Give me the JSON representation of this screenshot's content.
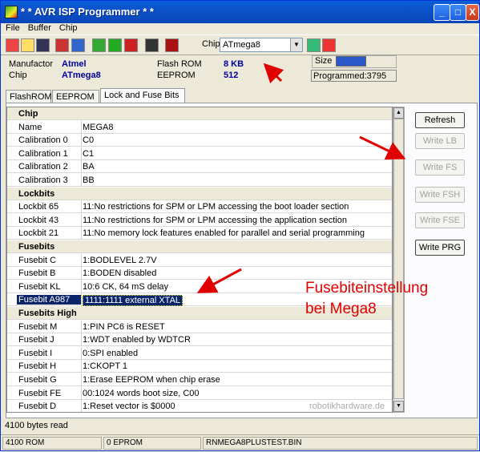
{
  "window": {
    "title": "* * AVR ISP Programmer * *",
    "min": "_",
    "max": "□",
    "close": "X"
  },
  "menu": [
    "File",
    "Buffer",
    "Chip"
  ],
  "toolbar": {
    "chip_label": "Chip",
    "chip_value": "ATmega8"
  },
  "info": {
    "manufacturer_label": "Manufactor",
    "manufacturer": "Atmel",
    "chip_label": "Chip",
    "chip": "ATmega8",
    "flash_label": "Flash ROM",
    "flash": "8 KB",
    "eeprom_label": "EEPROM",
    "eeprom": "512",
    "size_label": "Size",
    "programmed": "Programmed:3795"
  },
  "tabs": [
    "FlashROM",
    "EEPROM",
    "Lock and Fuse Bits"
  ],
  "rows": [
    {
      "n": "Chip",
      "h": true
    },
    {
      "n": "Name",
      "v": "MEGA8"
    },
    {
      "n": "Calibration 0",
      "v": "C0"
    },
    {
      "n": "Calibration 1",
      "v": "C1"
    },
    {
      "n": "Calibration 2",
      "v": "BA"
    },
    {
      "n": "Calibration 3",
      "v": "BB"
    },
    {
      "n": "Lockbits",
      "h": true
    },
    {
      "n": "Lockbit 65",
      "v": "11:No restrictions for SPM or LPM accessing the boot loader section"
    },
    {
      "n": "Lockbit 43",
      "v": "11:No restrictions for SPM or LPM accessing the application section"
    },
    {
      "n": "Lockbit 21",
      "v": "11:No memory lock features enabled for parallel and serial programming"
    },
    {
      "n": "Fusebits",
      "h": true
    },
    {
      "n": "Fusebit C",
      "v": "1:BODLEVEL 2.7V"
    },
    {
      "n": "Fusebit B",
      "v": "1:BODEN disabled"
    },
    {
      "n": "Fusebit KL",
      "v": "10:6 CK, 64 mS delay"
    },
    {
      "n": "Fusebit A987",
      "v": "1111:1111 external XTAL",
      "s": true
    },
    {
      "n": "Fusebits High",
      "h": true
    },
    {
      "n": "Fusebit M",
      "v": "1:PIN PC6 is RESET"
    },
    {
      "n": "Fusebit J",
      "v": "1:WDT enabled by WDTCR"
    },
    {
      "n": "Fusebit I",
      "v": "0:SPI enabled"
    },
    {
      "n": "Fusebit H",
      "v": "1:CKOPT 1"
    },
    {
      "n": "Fusebit G",
      "v": "1:Erase EEPROM when chip erase"
    },
    {
      "n": "Fusebit FE",
      "v": "00:1024 words boot size, C00"
    },
    {
      "n": "Fusebit D",
      "v": "1:Reset vector is $0000"
    }
  ],
  "buttons": [
    "Refresh",
    "Write LB",
    "Write FS",
    "Write FSH",
    "Write FSE",
    "Write PRG"
  ],
  "status_line": "4100 bytes read",
  "statusbar": [
    "4100 ROM",
    "0 EPROM",
    "RNMEGA8PLUSTEST.BIN"
  ],
  "annotation": [
    "Fusebiteinstellung",
    "bei Mega8"
  ],
  "watermark": "robotikhardware.de",
  "colors": {
    "arrow": "#e00000",
    "value": "#0000a0",
    "selection": "#0a246a"
  }
}
